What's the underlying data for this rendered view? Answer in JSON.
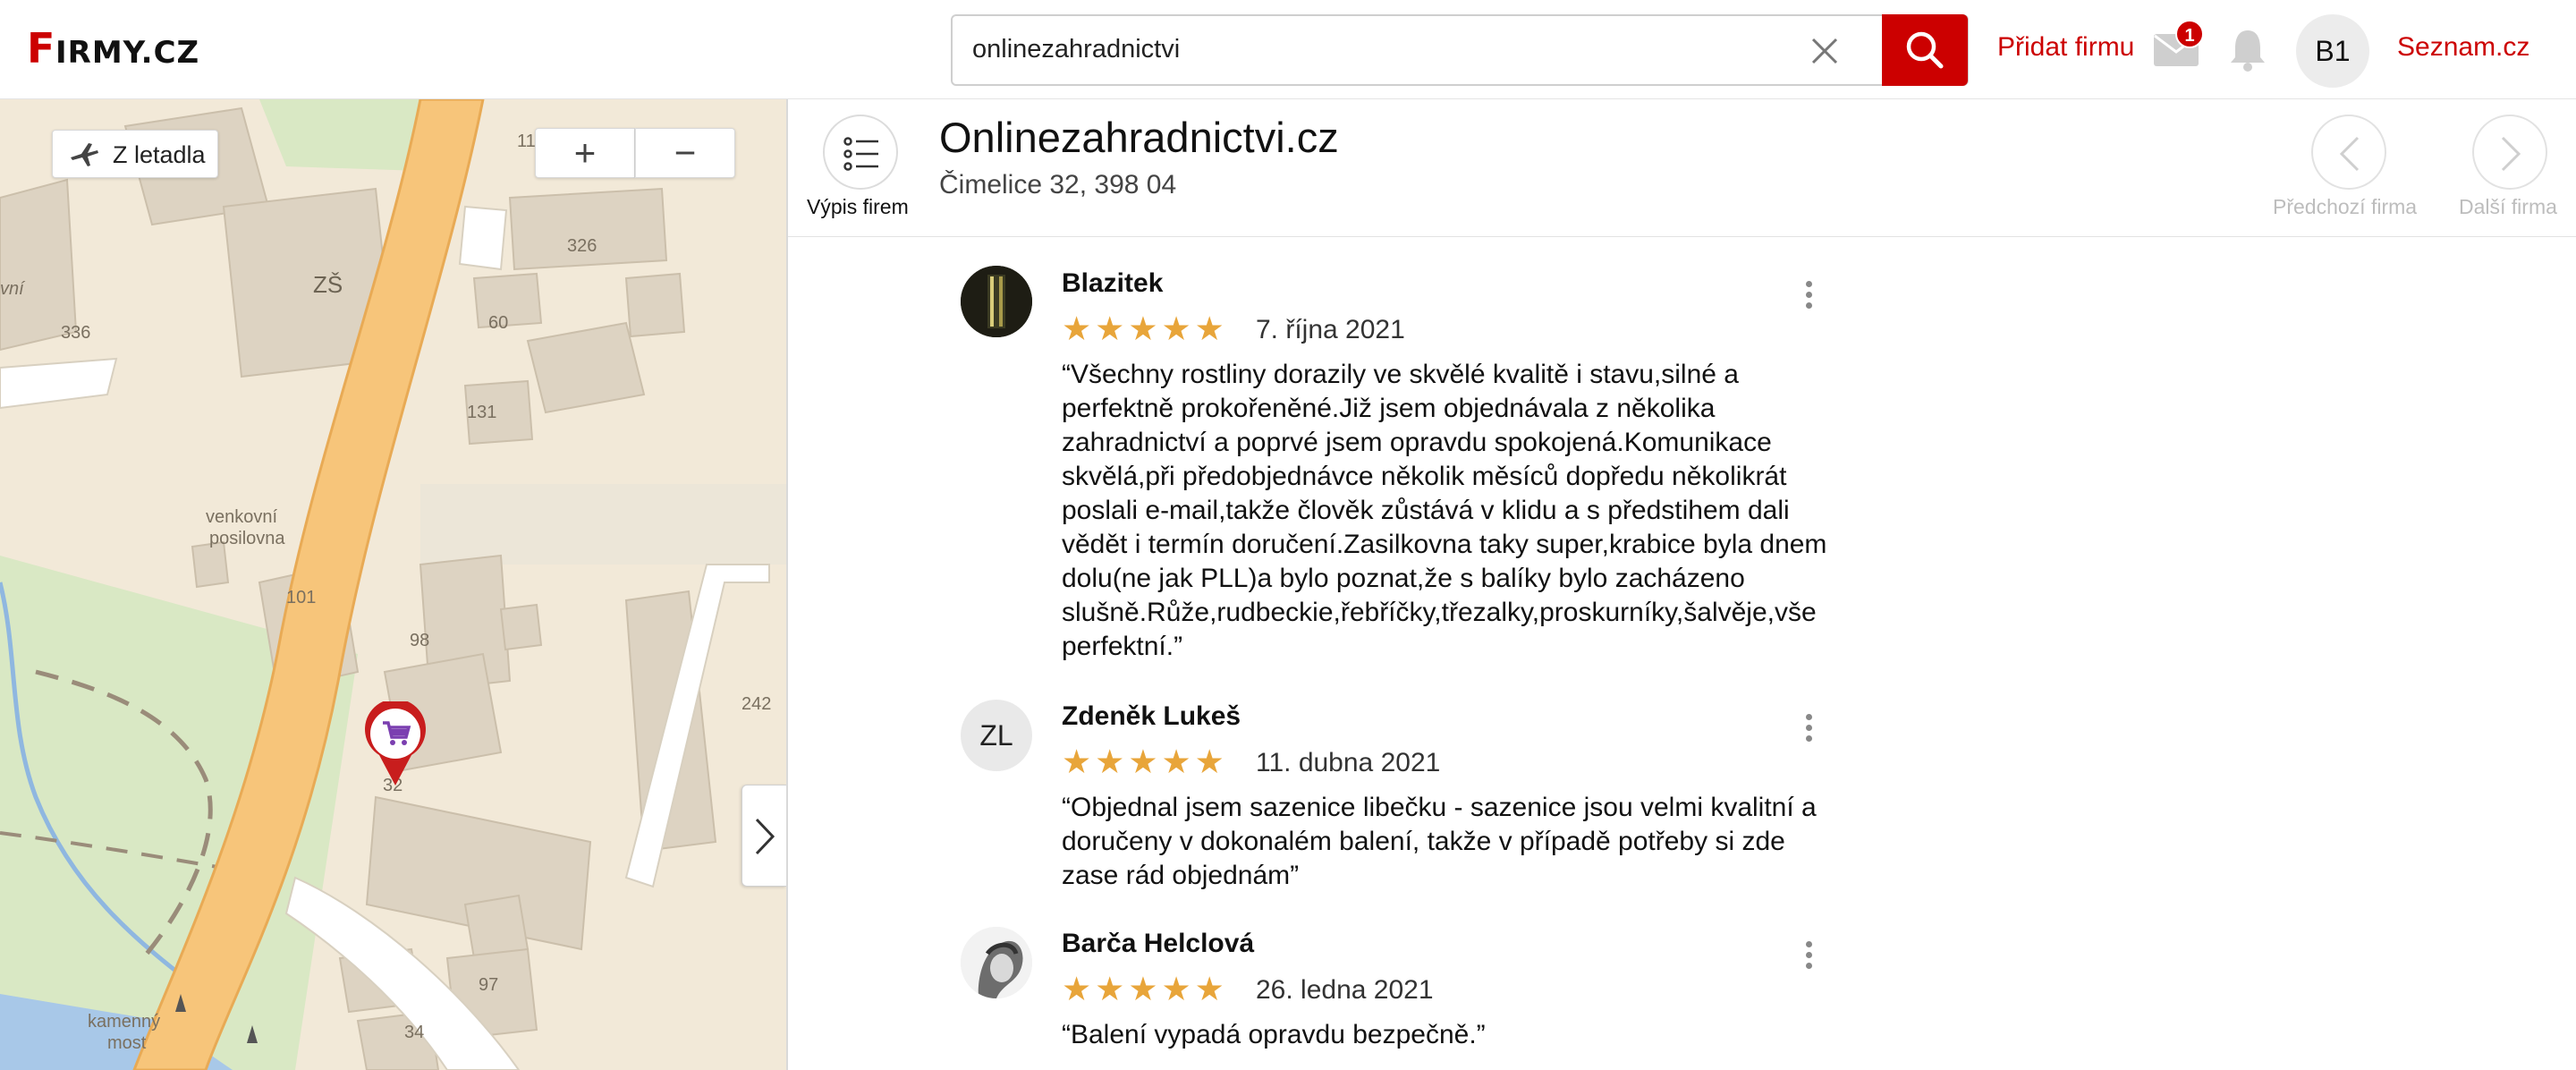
{
  "header": {
    "logo_text": "Firmy.cz",
    "search_value": "onlinezahradnictvi",
    "add_firm_label": "Přidat firmu",
    "mail_badge": "1",
    "avatar_initials": "B1",
    "seznam_label": "Seznam.cz"
  },
  "map": {
    "plane_button_label": "Z letadla",
    "zoom_in_label": "+",
    "zoom_out_label": "−",
    "labels": {
      "school": "ZŠ",
      "outdoor_gym_line1": "venkovní",
      "outdoor_gym_line2": "posilovna",
      "stone_line1": "kamenný",
      "stone_line2": "most",
      "partial_left": "vní",
      "n11": "11",
      "n326": "326",
      "n336": "336",
      "n60": "60",
      "n131": "131",
      "n101": "101",
      "n98": "98",
      "n242": "242",
      "n32": "32",
      "n97": "97",
      "n34": "34"
    }
  },
  "firm": {
    "list_label": "Výpis firem",
    "name": "Onlinezahradnictvi.cz",
    "address": "Čimelice 32, 398 04",
    "prev_label": "Předchozí firma",
    "next_label": "Další firma"
  },
  "reviews": [
    {
      "author": "Blazitek",
      "rating": 5,
      "stars": "★★★★★",
      "date": "7. října 2021",
      "text_lines": [
        "“Všechny rostliny dorazily ve skvělé kvalitě i stavu,silné a",
        "perfektně prokořeněné.Již jsem objednávala z několika",
        "zahradnictví a poprvé jsem opravdu spokojená.Komunikace",
        "skvělá,při předobjednávce několik měsíců dopředu několikrát",
        "poslali e-mail,takže člověk zůstává v klidu a s předstihem dali",
        "vědět i termín doručení.Zasilkovna taky super,krabice byla dnem",
        "dolu(ne jak PLL)a bylo poznat,že s balíky bylo zacházeno",
        "slušně.Růže,rudbeckie,řebříčky,třezalky,proskurníky,šalvěje,vše",
        "perfektní.”"
      ]
    },
    {
      "author": "Zdeněk Lukeš",
      "initials": "ZL",
      "rating": 5,
      "stars": "★★★★★",
      "date": "11. dubna 2021",
      "text_lines": [
        "“Objednal jsem sazenice libečku - sazenice jsou velmi kvalitní a",
        "doručeny v dokonalém balení, takže v případě potřeby si zde",
        "zase rád objednám”"
      ]
    },
    {
      "author": "Barča Helclová",
      "rating": 5,
      "stars": "★★★★★",
      "date": "26. ledna 2021",
      "text_lines": [
        "“Balení vypadá opravdu bezpečně.”"
      ]
    }
  ],
  "colors": {
    "brand_red": "#cc0000",
    "star": "#e8a53a",
    "road": "#f7c57a",
    "park": "#d9e8c4",
    "building": "#ddd3c2"
  }
}
